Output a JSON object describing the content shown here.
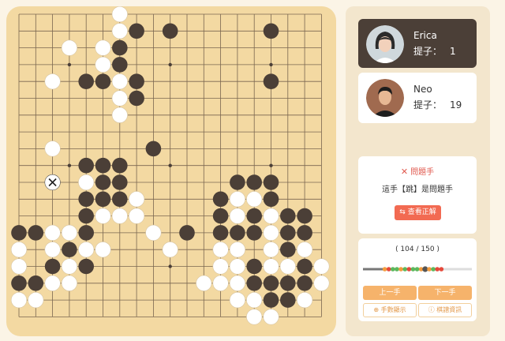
{
  "colors": {
    "board": "#f3d9a2",
    "black_stone": "#4b3f37",
    "white_stone": "#ffffff",
    "accent": "#f26a52",
    "nav_button": "#f6b36b"
  },
  "board": {
    "size": 19,
    "star_points": [
      [
        3,
        3
      ],
      [
        3,
        9
      ],
      [
        3,
        15
      ],
      [
        9,
        3
      ],
      [
        9,
        9
      ],
      [
        9,
        15
      ],
      [
        15,
        3
      ],
      [
        15,
        9
      ],
      [
        15,
        15
      ]
    ],
    "black": [
      [
        1,
        7
      ],
      [
        1,
        9
      ],
      [
        1,
        15
      ],
      [
        2,
        6
      ],
      [
        3,
        6
      ],
      [
        4,
        4
      ],
      [
        4,
        5
      ],
      [
        4,
        7
      ],
      [
        4,
        15
      ],
      [
        5,
        7
      ],
      [
        8,
        8
      ],
      [
        9,
        4
      ],
      [
        9,
        5
      ],
      [
        9,
        6
      ],
      [
        10,
        5
      ],
      [
        10,
        6
      ],
      [
        11,
        4
      ],
      [
        11,
        5
      ],
      [
        11,
        6
      ],
      [
        12,
        4
      ],
      [
        13,
        0
      ],
      [
        13,
        1
      ],
      [
        13,
        4
      ],
      [
        13,
        10
      ],
      [
        14,
        3
      ],
      [
        15,
        2
      ],
      [
        15,
        4
      ],
      [
        16,
        0
      ],
      [
        16,
        1
      ],
      [
        10,
        13
      ],
      [
        10,
        14
      ],
      [
        10,
        15
      ],
      [
        11,
        12
      ],
      [
        11,
        15
      ],
      [
        12,
        12
      ],
      [
        12,
        14
      ],
      [
        12,
        16
      ],
      [
        12,
        17
      ],
      [
        13,
        12
      ],
      [
        13,
        13
      ],
      [
        13,
        14
      ],
      [
        13,
        16
      ],
      [
        13,
        17
      ],
      [
        14,
        16
      ],
      [
        15,
        14
      ],
      [
        15,
        17
      ],
      [
        16,
        14
      ],
      [
        16,
        15
      ],
      [
        16,
        16
      ],
      [
        16,
        17
      ],
      [
        17,
        15
      ],
      [
        17,
        16
      ]
    ],
    "white": [
      [
        0,
        6
      ],
      [
        1,
        6
      ],
      [
        2,
        3
      ],
      [
        2,
        5
      ],
      [
        3,
        5
      ],
      [
        4,
        2
      ],
      [
        4,
        6
      ],
      [
        5,
        6
      ],
      [
        6,
        6
      ],
      [
        8,
        2
      ],
      [
        10,
        4
      ],
      [
        11,
        7
      ],
      [
        12,
        5
      ],
      [
        12,
        6
      ],
      [
        12,
        7
      ],
      [
        13,
        2
      ],
      [
        13,
        3
      ],
      [
        13,
        8
      ],
      [
        14,
        0
      ],
      [
        14,
        2
      ],
      [
        14,
        4
      ],
      [
        14,
        5
      ],
      [
        15,
        3
      ],
      [
        15,
        0
      ],
      [
        16,
        2
      ],
      [
        16,
        3
      ],
      [
        17,
        0
      ],
      [
        17,
        1
      ],
      [
        14,
        9
      ],
      [
        12,
        13
      ],
      [
        13,
        15
      ],
      [
        14,
        17
      ],
      [
        15,
        18
      ],
      [
        16,
        18
      ],
      [
        11,
        13
      ],
      [
        11,
        14
      ],
      [
        12,
        15
      ],
      [
        14,
        12
      ],
      [
        14,
        13
      ],
      [
        14,
        15
      ],
      [
        15,
        13
      ],
      [
        15,
        16
      ],
      [
        16,
        13
      ],
      [
        17,
        13
      ],
      [
        17,
        14
      ],
      [
        18,
        14
      ],
      [
        18,
        15
      ],
      [
        15,
        12
      ],
      [
        16,
        12
      ],
      [
        15,
        15
      ],
      [
        16,
        11
      ],
      [
        17,
        17
      ]
    ],
    "problem_mark": [
      10,
      2
    ]
  },
  "players": [
    {
      "name": "Erica",
      "captures_label": "提子：",
      "captures": "1"
    },
    {
      "name": "Neo",
      "captures_label": "提子：",
      "captures": "19"
    }
  ],
  "problem": {
    "icon": "close-icon",
    "title": "問題手",
    "message": "這手【跳】是問題手",
    "button": "查看正解",
    "button_icon": "swap-icon"
  },
  "navigation": {
    "move_counter": "( 104 / 150 )",
    "timeline_markers": [
      "orange",
      "red",
      "green",
      "green",
      "orange",
      "green",
      "red",
      "green",
      "green",
      "orange",
      "dark",
      "orange",
      "green",
      "red",
      "red"
    ],
    "current_move": 104,
    "total_moves": 150,
    "prev_label": "上一手",
    "next_label": "下一手",
    "show_numbers_label": "手數顯示",
    "show_numbers_icon": "plus-circle-icon",
    "info_label": "棋譜資訊",
    "info_icon": "info-circle-icon"
  }
}
